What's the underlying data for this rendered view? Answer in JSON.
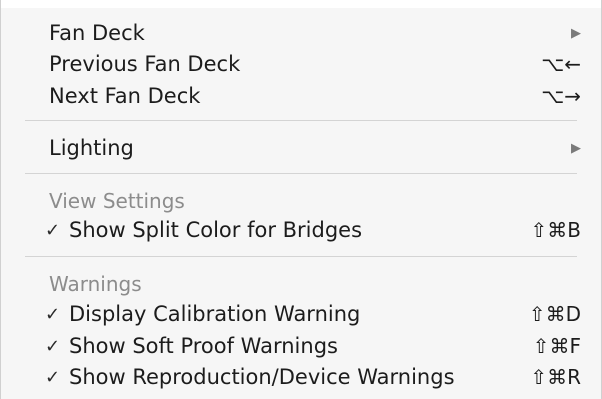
{
  "menu": {
    "fan_deck": {
      "label": "Fan Deck",
      "submenu_icon": "submenu-arrow-icon"
    },
    "previous_fan_deck": {
      "label": "Previous Fan Deck",
      "shortcut": "⌥←"
    },
    "next_fan_deck": {
      "label": "Next Fan Deck",
      "shortcut": "⌥→"
    },
    "lighting": {
      "label": "Lighting",
      "submenu_icon": "submenu-arrow-icon"
    },
    "view_settings": {
      "header": "View Settings",
      "items": [
        {
          "label": "Show Split Color for Bridges",
          "shortcut": "⇧⌘B",
          "checked": true
        }
      ]
    },
    "warnings": {
      "header": "Warnings",
      "items": [
        {
          "label": "Display Calibration Warning",
          "shortcut": "⇧⌘D",
          "checked": true
        },
        {
          "label": "Show Soft Proof Warnings",
          "shortcut": "⇧⌘F",
          "checked": true
        },
        {
          "label": "Show Reproduction/Device Warnings",
          "shortcut": "⇧⌘R",
          "checked": true
        }
      ]
    },
    "check_glyph": "✓",
    "arrow_glyph": "▶"
  }
}
